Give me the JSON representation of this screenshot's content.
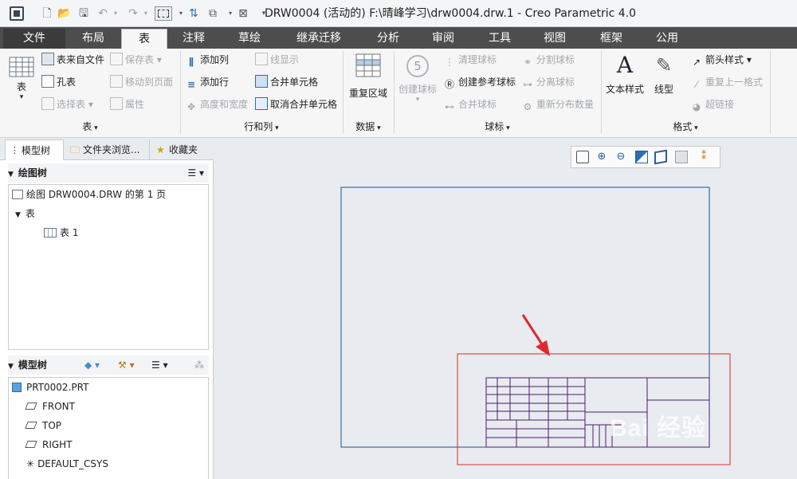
{
  "window": {
    "title": "DRW0004 (活动的) F:\\晴峰学习\\drw0004.drw.1 - Creo Parametric 4.0"
  },
  "tabs": [
    "文件",
    "布局",
    "表",
    "注释",
    "草绘",
    "继承迁移",
    "分析",
    "审阅",
    "工具",
    "视图",
    "框架",
    "公用"
  ],
  "ribbon": {
    "table_group": {
      "table_button": "表",
      "table_from_file": "表来自文件",
      "hole_table": "孔表",
      "select_table": "选择表",
      "save_table": "保存表",
      "move_to_page": "移动到页面",
      "properties": "属性",
      "label": "表"
    },
    "rows_cols_group": {
      "add_column": "添加列",
      "add_row": "添加行",
      "height_width": "高度和宽度",
      "line_display": "线显示",
      "merge_cells": "合并单元格",
      "unmerge_cells": "取消合并单元格",
      "label": "行和列"
    },
    "data_group": {
      "repeat_region": "重复区域",
      "label": "数据"
    },
    "balloon_group": {
      "create_balloon": "创建球标",
      "clean_balloon": "清理球标",
      "create_ref_balloon": "创建参考球标",
      "merge_balloon": "合并球标",
      "split_balloon": "分割球标",
      "detach_balloon": "分离球标",
      "redistribute_qty": "重新分布数量",
      "label": "球标"
    },
    "format_group": {
      "text_style": "文本样式",
      "line_style": "线型",
      "arrow_style": "箭头样式",
      "repeat_last_format": "重复上一格式",
      "hyperlink": "超链接",
      "label": "格式"
    }
  },
  "left_panel": {
    "tabs": [
      "模型树",
      "文件夹浏览...",
      "收藏夹"
    ],
    "drawing_tree": {
      "header": "绘图树",
      "items": [
        "绘图 DRW0004.DRW 的第 1 页",
        "表",
        "表 1"
      ]
    },
    "model_tree": {
      "header": "模型树",
      "items": [
        "PRT0002.PRT",
        "FRONT",
        "TOP",
        "RIGHT",
        "DEFAULT_CSYS"
      ]
    }
  },
  "colors": {
    "tab_bar": "#4d4d4d",
    "sheet_border": "#1f4f96",
    "table_lines": "#4a1c6b",
    "highlight_box": "#e0282a",
    "arrow": "#e0282a"
  },
  "watermark": "Bai 经验"
}
